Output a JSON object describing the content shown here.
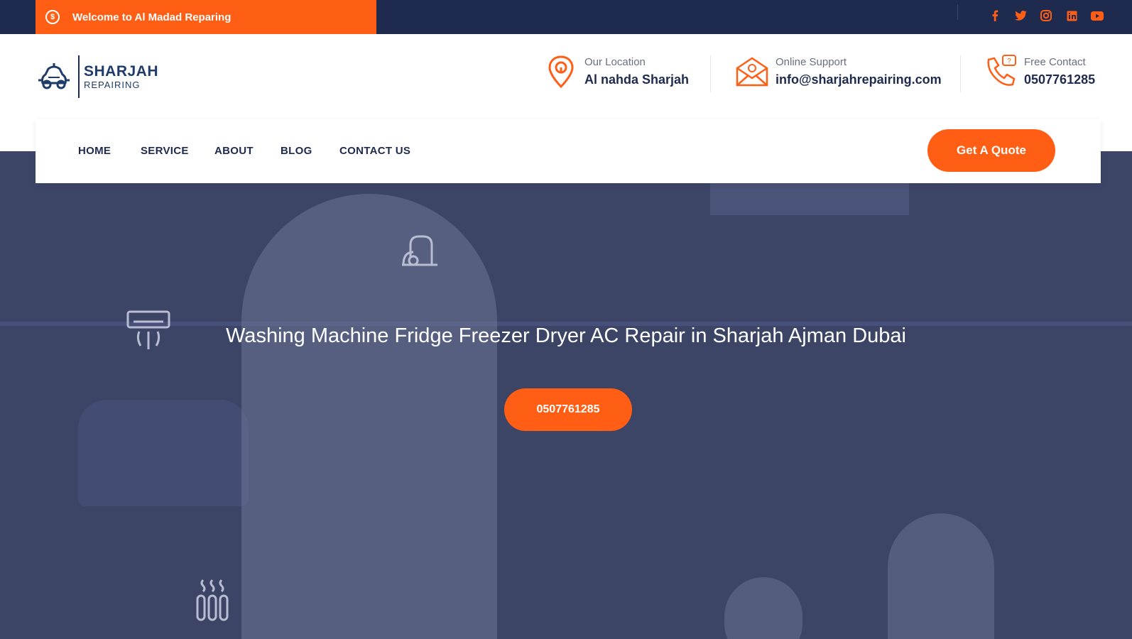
{
  "topbar": {
    "welcome_text": "Welcome to Al Madad Reparing",
    "social_icons": [
      "facebook-icon",
      "twitter-icon",
      "instagram-icon",
      "linkedin-icon",
      "youtube-icon"
    ]
  },
  "logo": {
    "line1": "SHARJAH",
    "line2": "REPAIRING"
  },
  "contacts": [
    {
      "title": "Our Location",
      "value": "Al nahda Sharjah",
      "icon": "location-pin-icon"
    },
    {
      "title": "Online Support",
      "value": "info@sharjahrepairing.com",
      "icon": "email-icon"
    },
    {
      "title": "Free Contact",
      "value": "0507761285",
      "icon": "phone-icon"
    }
  ],
  "nav": {
    "items": [
      "HOME",
      "SERVICE",
      "ABOUT",
      "BLOG",
      "CONTACT US"
    ],
    "quote_label": "Get A Quote"
  },
  "hero": {
    "title": "Washing Machine Fridge Freezer Dryer AC Repair in Sharjah Ajman Dubai",
    "button_label": "0507761285"
  },
  "colors": {
    "accent": "#ff5e14",
    "navy": "#1f2a4f",
    "hero_overlay": "#3c4566"
  }
}
